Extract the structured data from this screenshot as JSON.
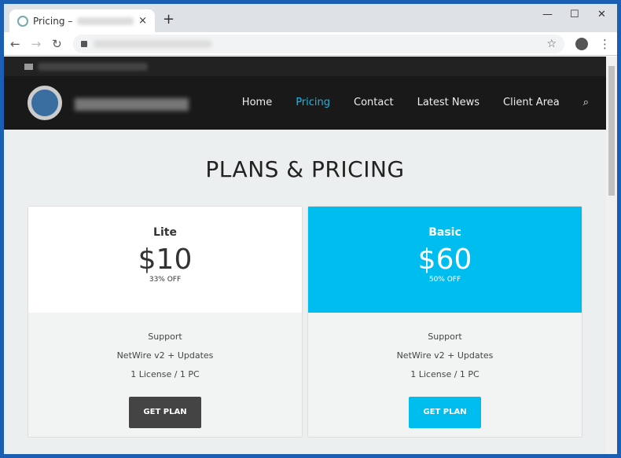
{
  "browser": {
    "tab_title": "Pricing –",
    "close": "×",
    "new_tab": "+",
    "back": "←",
    "forward": "→",
    "reload": "↻",
    "minimize": "—",
    "maximize": "☐",
    "close_window": "✕",
    "bookmark": "☆",
    "menu": "⋮"
  },
  "nav": {
    "items": [
      "Home",
      "Pricing",
      "Contact",
      "Latest News",
      "Client Area"
    ],
    "active": "Pricing",
    "search_icon": "⌕",
    "accent": "#19b6e6"
  },
  "page": {
    "title": "PLANS & PRICING"
  },
  "plans": [
    {
      "name": "Lite",
      "price": "$10",
      "discount": "33% OFF",
      "features": [
        "Support",
        "NetWire v2 + Updates",
        "1 License / 1 PC"
      ],
      "button": "GET PLAN"
    },
    {
      "name": "Basic",
      "price": "$60",
      "discount": "50% OFF",
      "features": [
        "Support",
        "NetWire v2 + Updates",
        "1 License / 1 PC"
      ],
      "button": "GET PLAN",
      "color": "#00bdef"
    }
  ]
}
